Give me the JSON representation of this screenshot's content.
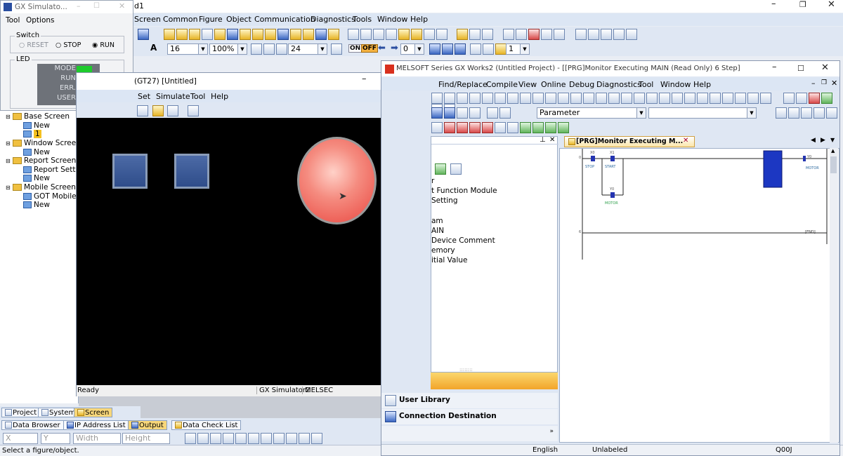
{
  "gtd_window": {
    "title_suffix": "d1",
    "menu": [
      "Screen",
      "Common",
      "Figure",
      "Object",
      "Communication",
      "Diagnostics",
      "Tools",
      "Window",
      "Help"
    ],
    "toolbar2": {
      "font_size": "16",
      "zoom": "100%",
      "size_value": "24",
      "on": "ON",
      "off": "OFF",
      "step_value": "0",
      "page_value": "1"
    },
    "tree": {
      "base_screen": "Base Screen",
      "new1": "New",
      "screen1": "1",
      "window_screen": "Window Screen",
      "new2": "New",
      "report_screen": "Report Screen",
      "report_setting": "Report Settin",
      "new3": "New",
      "mobile_screen": "Mobile Screen",
      "got_mobile": "GOT Mobile S",
      "new4": "New"
    },
    "bottom_tabs": [
      "Project",
      "System",
      "Screen"
    ],
    "dock_tabs": [
      "Data Browser",
      "IP Address List",
      "Output",
      "Data Check List"
    ],
    "props": {
      "x": "X",
      "y": "Y",
      "width": "Width",
      "height": "Height"
    },
    "status": "Select a figure/object."
  },
  "simulator": {
    "title": "GX Simulato...",
    "menu": [
      "Tool",
      "Options"
    ],
    "switch_label": "Switch",
    "switch_options": [
      "RESET",
      "STOP",
      "RUN"
    ],
    "switch_selected": "RUN",
    "led_label": "LED",
    "leds": [
      {
        "name": "MODE",
        "color": "#1ecb2c"
      },
      {
        "name": "RUN",
        "color": "#1ecb2c"
      },
      {
        "name": "ERR.",
        "color": "#cfd2d6"
      },
      {
        "name": "USER",
        "color": "#cfd2d6"
      }
    ]
  },
  "gt_window": {
    "title": "(GT27)  [Untitled]",
    "menu": [
      "Set",
      "Simulate",
      "Tool",
      "Help"
    ],
    "status": "Ready",
    "status_right": [
      "GX Simulator2",
      "MELSEC"
    ]
  },
  "gxworks": {
    "title": "MELSOFT Series GX Works2 (Untitled Project) - [[PRG]Monitor Executing MAIN (Read Only) 6 Step]",
    "menu": [
      "Find/Replace",
      "Compile",
      "View",
      "Online",
      "Debug",
      "Diagnostics",
      "Tool",
      "Window",
      "Help"
    ],
    "parameter_dropdown": "Parameter",
    "nav_items": [
      "r",
      "t Function Module",
      "Setting",
      "am",
      "AIN",
      "Device Comment",
      "emory",
      "itial Value"
    ],
    "user_library": "User Library",
    "connection_destination": "Connection Destination",
    "ladder_tab": "[PRG]Monitor Executing M...",
    "status": {
      "language": "English",
      "label": "Unlabeled",
      "cpu": "Q00J"
    },
    "ladder": {
      "step0": "0",
      "step6": "6",
      "contact1_dev": "X0",
      "contact1_label": "STOP",
      "contact2_dev": "X1",
      "contact2_label": "START",
      "parallel_dev": "Y0",
      "parallel_label": "MOTOR",
      "coil_dev": "Y0",
      "coil_label": "MOTOR",
      "end_label": "[END]"
    }
  },
  "colors": {
    "led_on": "#1ecb2c",
    "lamp": "#f05a55",
    "menubar": "#dce6f4"
  }
}
